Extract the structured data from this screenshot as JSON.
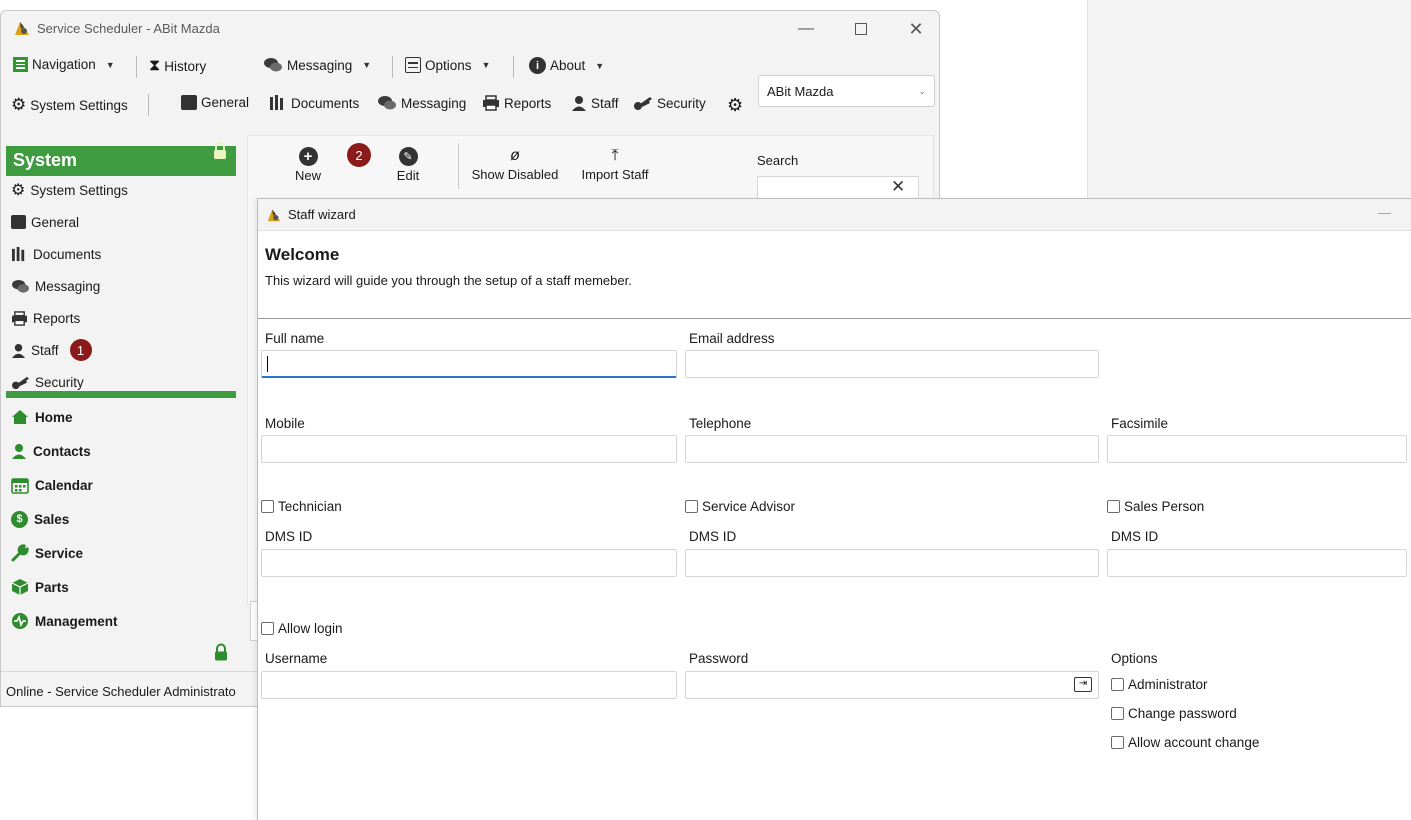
{
  "main_window": {
    "title": "Service Scheduler - ABit Mazda",
    "menu": {
      "navigation": "Navigation",
      "history": "History",
      "messaging": "Messaging",
      "options": "Options",
      "about": "About"
    },
    "toolbar": {
      "system_settings": "System Settings",
      "general": "General",
      "documents": "Documents",
      "messaging": "Messaging",
      "reports": "Reports",
      "staff": "Staff",
      "security": "Security"
    },
    "site_select": "ABit Mazda",
    "sidebar": {
      "header": "System",
      "items": [
        "System Settings",
        "General",
        "Documents",
        "Messaging",
        "Reports",
        "Staff",
        "Security"
      ],
      "staff_badge": "1",
      "nav": [
        "Home",
        "Contacts",
        "Calendar",
        "Sales",
        "Service",
        "Parts",
        "Management"
      ]
    },
    "actions": {
      "new": "New",
      "edit": "Edit",
      "show_disabled": "Show Disabled",
      "import_staff": "Import Staff",
      "badge": "2",
      "search_label": "Search"
    },
    "status": "Online - Service Scheduler Administrato"
  },
  "wizard": {
    "title": "Staff wizard",
    "heading": "Welcome",
    "subtitle": "This wizard will guide you through the setup of a staff memeber.",
    "fields": {
      "full_name": "Full name",
      "email": "Email address",
      "mobile": "Mobile",
      "telephone": "Telephone",
      "facsimile": "Facsimile",
      "dms_id": "DMS ID",
      "username": "Username",
      "password": "Password",
      "options": "Options"
    },
    "checkboxes": {
      "technician": "Technician",
      "service_advisor": "Service Advisor",
      "sales_person": "Sales Person",
      "allow_login": "Allow login",
      "administrator": "Administrator",
      "change_password": "Change password",
      "allow_account_change": "Allow account change"
    }
  },
  "colors": {
    "accent_green": "#3f9b3f",
    "badge_red": "#8b1a1a"
  }
}
